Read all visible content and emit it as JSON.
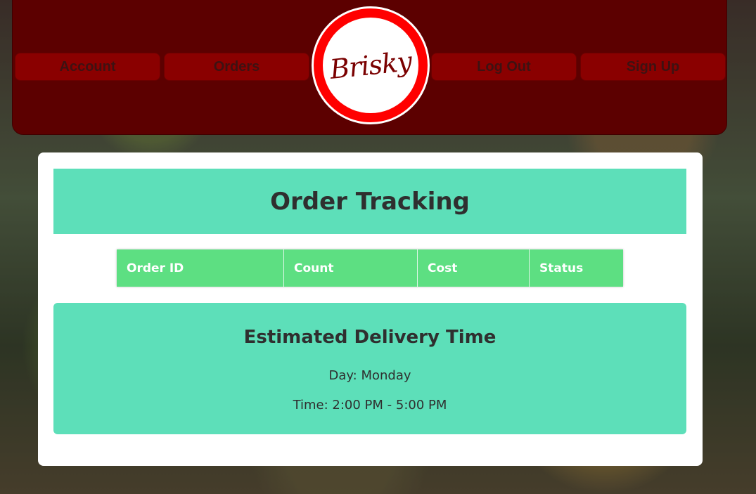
{
  "nav": {
    "account_label": "Account",
    "orders_label": "Orders",
    "logout_label": "Log Out",
    "signup_label": "Sign Up"
  },
  "brand": {
    "logo_text": "Brisky"
  },
  "page": {
    "title": "Order Tracking"
  },
  "orders_table": {
    "columns": [
      "Order ID",
      "Count",
      "Cost",
      "Status"
    ],
    "rows": []
  },
  "delivery": {
    "title": "Estimated Delivery Time",
    "day_line": "Day: Monday",
    "time_line": "Time: 2:00 PM - 5:00 PM"
  },
  "colors": {
    "header": "#5c0000",
    "nav_button": "#8a0000",
    "logo_ring": "#ff0000",
    "teal_panel": "#5ddfb9",
    "table_header": "#5ddf82"
  }
}
